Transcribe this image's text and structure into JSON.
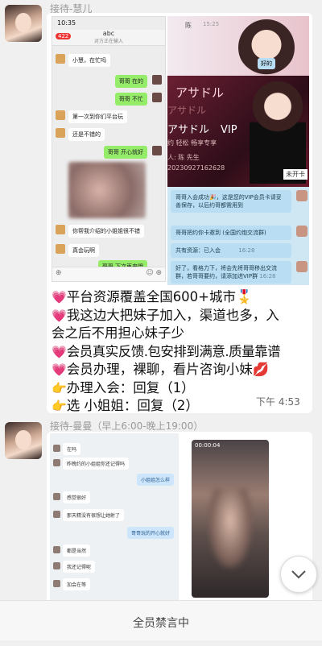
{
  "message1": {
    "sender": "接待-慧儿",
    "screenshot_left": {
      "status_time": "10:35",
      "header_title": "abc",
      "header_sub": "对方正在输入",
      "back_badge": "422",
      "messages": [
        {
          "side": "in",
          "text": "小慧，在忙吗"
        },
        {
          "side": "out",
          "text": "哥哥 在的"
        },
        {
          "side": "out",
          "text": "哥哥 不忙"
        },
        {
          "side": "in",
          "text": "第一次到你们平台玩"
        },
        {
          "side": "in",
          "text": "还是不错的"
        },
        {
          "side": "out",
          "text": "哥哥 开心就好"
        },
        {
          "side": "in",
          "text": "你帮我介绍的小姐姐很不错"
        },
        {
          "side": "in",
          "text": "真会玩啊"
        },
        {
          "side": "out",
          "text": "哥哥 下次再来哦"
        }
      ]
    },
    "screenshot_right": {
      "name_chip": "陈",
      "time1": "15:25",
      "reply": "好的",
      "card_title": "アサドル",
      "card_sub": "アサドル",
      "card_vip_left": "アサドル",
      "card_vip": "VIP",
      "card_line1": "约 轻松 畅享专享",
      "card_line2": "人: 陈 先生",
      "card_line3": "20230927162628",
      "tag": "未开卡",
      "blue1": "哥哥入会成功🎉，这是您的VIP会员卡请妥善保存，以后约哥都需用到",
      "blue2": "哥哥把约你卡邀到 (全国约炮交流群)",
      "blue3": "共有资源：已入会",
      "time2": "16:28",
      "blue4": "好了，看格力下，将会先将哥哥移出交流群，若哥哥要约，请添加进VIP群",
      "time3": "16:28"
    },
    "promo_lines": [
      {
        "icon": "💗",
        "text": "平台资源覆盖全国600+城市🎖️"
      },
      {
        "icon": "💗",
        "text": "我这边大把妹子加入，渠道也多，入"
      },
      {
        "icon": "",
        "text": "会之后不用担心妹子少"
      },
      {
        "icon": "💗",
        "text": "会员真实反馈.包安排到满意.质量靠谱"
      },
      {
        "icon": "💗",
        "text": "会员办理，裸聊，看片咨询小妹💋"
      },
      {
        "icon": "👉",
        "text": "办理入会：回复（1）"
      },
      {
        "icon": "👉",
        "text": "选 小姐姐：回复（2）"
      }
    ],
    "time": "下午 4:53"
  },
  "message2": {
    "sender": "接待-曼曼",
    "hours": "（早上6:00-晚上19:00）",
    "chat_messages": [
      {
        "side": "in",
        "text": "在吗"
      },
      {
        "side": "in",
        "text": "昨晚约的小姐姐你还记得吗"
      },
      {
        "side": "out",
        "text": "小姐姐怎么样"
      },
      {
        "side": "in",
        "text": "感觉很好"
      },
      {
        "side": "in",
        "text": "那天精没有很想让她射了"
      },
      {
        "side": "out",
        "text": "哥哥玩的开心就好"
      },
      {
        "side": "in",
        "text": "都是当然"
      },
      {
        "side": "in",
        "text": "我还记得呢"
      },
      {
        "side": "in",
        "text": "加会在等"
      }
    ],
    "video_time": "00:00:04"
  },
  "scroll_button_icon": "chevron-down-icon",
  "footer_text": "全员禁言中"
}
